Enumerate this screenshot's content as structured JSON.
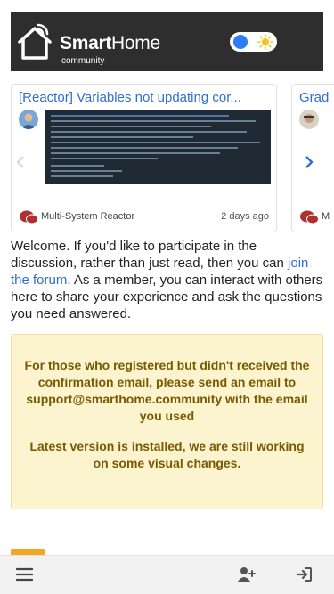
{
  "header": {
    "logo_title_bold": "Smart",
    "logo_title_rest": "Home",
    "logo_subtitle": "community",
    "theme_toggle": {
      "state": "light",
      "icons": [
        "moon-knob",
        "sun-icon"
      ]
    }
  },
  "carousel": {
    "cards": [
      {
        "title": "[Reactor] Variables not updating cor...",
        "category": "Multi-System Reactor",
        "date": "2 days ago"
      },
      {
        "title": "Grad",
        "category": "M",
        "date": ""
      }
    ],
    "prev_icon": "chevron-left-icon",
    "next_icon": "chevron-right-icon"
  },
  "welcome": {
    "before_link": "Welcome. If you'd like to participate in the discussion, rather than just read, then you can ",
    "link_text": "join the forum",
    "after_link": ". As a member, you can interact with others here to share your experience and ask the questions you need answered."
  },
  "notice": {
    "line1": "For those who registered but didn't received the confirmation email, please send an email to support@smarthome.community with the email you used",
    "line2": "Latest version is installed, we are still working on some visual changes."
  },
  "bottom_bar": {
    "icons": [
      "hamburger-menu-icon",
      "user-plus-icon",
      "sign-in-icon"
    ]
  },
  "colors": {
    "header_bg": "#2e2e2e",
    "link": "#2f6fd0",
    "notice_bg": "#fcf3cf",
    "notice_text": "#7a5a00",
    "toggle_knob": "#2f7df6",
    "sun": "#f5c518",
    "category_icon": "#b03030"
  }
}
